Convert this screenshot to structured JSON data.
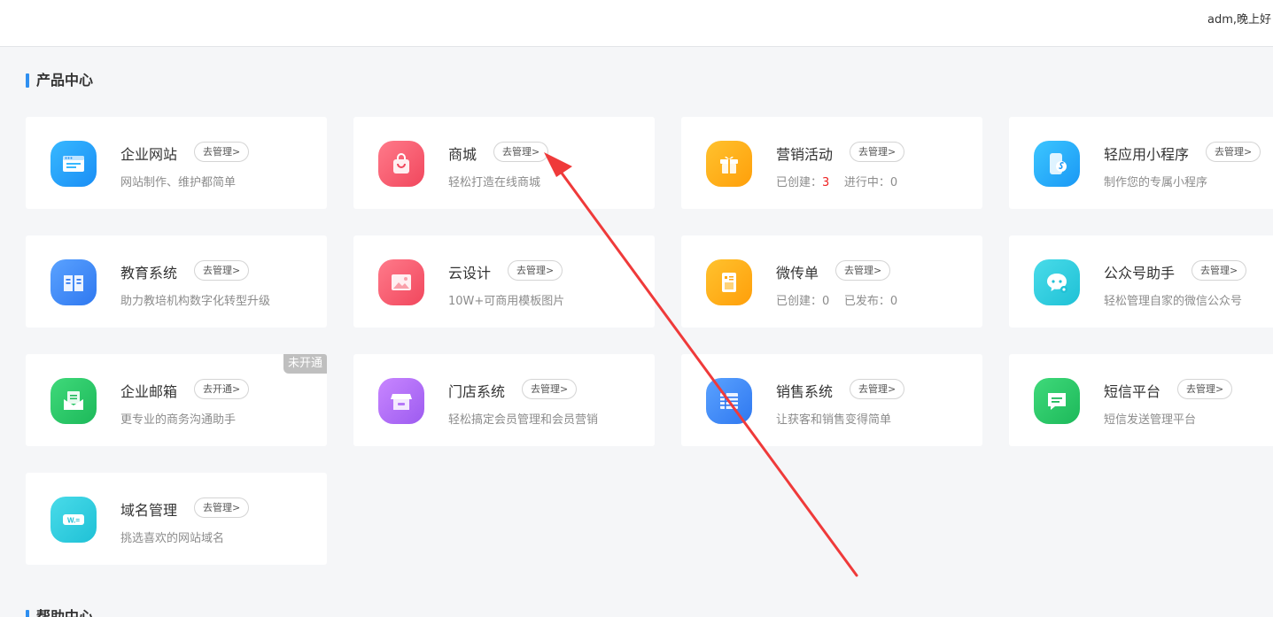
{
  "header": {
    "greeting": "adm,晚上好"
  },
  "sections": {
    "products": "产品中心",
    "help": "帮助中心"
  },
  "cards": [
    {
      "name": "企业网站",
      "action": "去管理>",
      "desc": "网站制作、维护都简单",
      "icon": "website-icon"
    },
    {
      "name": "商城",
      "action": "去管理>",
      "desc": "轻松打造在线商城",
      "icon": "shopping-bag-icon"
    },
    {
      "name": "营销活动",
      "action": "去管理>",
      "stat1_label": "已创建：",
      "stat1_value": "3",
      "stat2_label": "进行中：",
      "stat2_value": "0",
      "icon": "gift-icon"
    },
    {
      "name": "轻应用小程序",
      "action": "去管理>",
      "desc": "制作您的专属小程序",
      "icon": "mini-program-icon"
    },
    {
      "name": "教育系统",
      "action": "去管理>",
      "desc": "助力教培机构数字化转型升级",
      "icon": "book-icon"
    },
    {
      "name": "云设计",
      "action": "去管理>",
      "desc": "10W+可商用模板图片",
      "icon": "image-icon"
    },
    {
      "name": "微传单",
      "action": "去管理>",
      "stat1_label": "已创建：",
      "stat1_value": "0",
      "stat2_label": "已发布：",
      "stat2_value": "0",
      "icon": "flyer-icon"
    },
    {
      "name": "公众号助手",
      "action": "去管理>",
      "desc": "轻松管理自家的微信公众号",
      "icon": "wechat-chat-icon"
    },
    {
      "name": "企业邮箱",
      "action": "去开通>",
      "desc": "更专业的商务沟通助手",
      "badge": "未开通",
      "icon": "mail-icon"
    },
    {
      "name": "门店系统",
      "action": "去管理>",
      "desc": "轻松搞定会员管理和会员营销",
      "icon": "store-icon"
    },
    {
      "name": "销售系统",
      "action": "去管理>",
      "desc": "让获客和销售变得简单",
      "icon": "list-icon"
    },
    {
      "name": "短信平台",
      "action": "去管理>",
      "desc": "短信发送管理平台",
      "icon": "sms-icon"
    },
    {
      "name": "域名管理",
      "action": "去管理>",
      "desc": "挑选喜欢的网站域名",
      "icon": "domain-icon",
      "icon_text": "W.="
    }
  ],
  "colors": {
    "accent": "#2f8ff0",
    "annotation_arrow": "#ef3a3a"
  }
}
